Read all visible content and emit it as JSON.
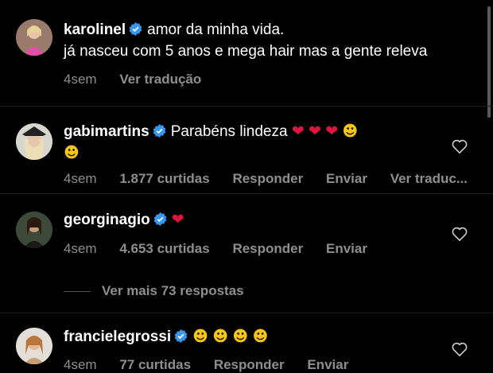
{
  "comments": [
    {
      "username": "karolinel",
      "text": "amor da minha vida.",
      "text2": "já nasceu com 5 anos e mega hair mas a gente releva",
      "time": "4sem",
      "translate": "Ver tradução"
    },
    {
      "username": "gabimartins",
      "text": "Parabéns lindeza",
      "time": "4sem",
      "likes": "1.877 curtidas",
      "reply": "Responder",
      "send": "Enviar",
      "translate": "Ver traduc..."
    },
    {
      "username": "georginagio",
      "time": "4sem",
      "likes": "4.653 curtidas",
      "reply": "Responder",
      "send": "Enviar"
    },
    {
      "username": "francielegrossi",
      "time": "4sem",
      "likes": "77 curtidas",
      "reply": "Responder",
      "send": "Enviar"
    }
  ],
  "more_replies": "Ver mais 73 respostas",
  "colors": {
    "background": "#000000",
    "muted": "#8e8e8e",
    "verified": "#3897f0",
    "heart": "#e0143c"
  }
}
